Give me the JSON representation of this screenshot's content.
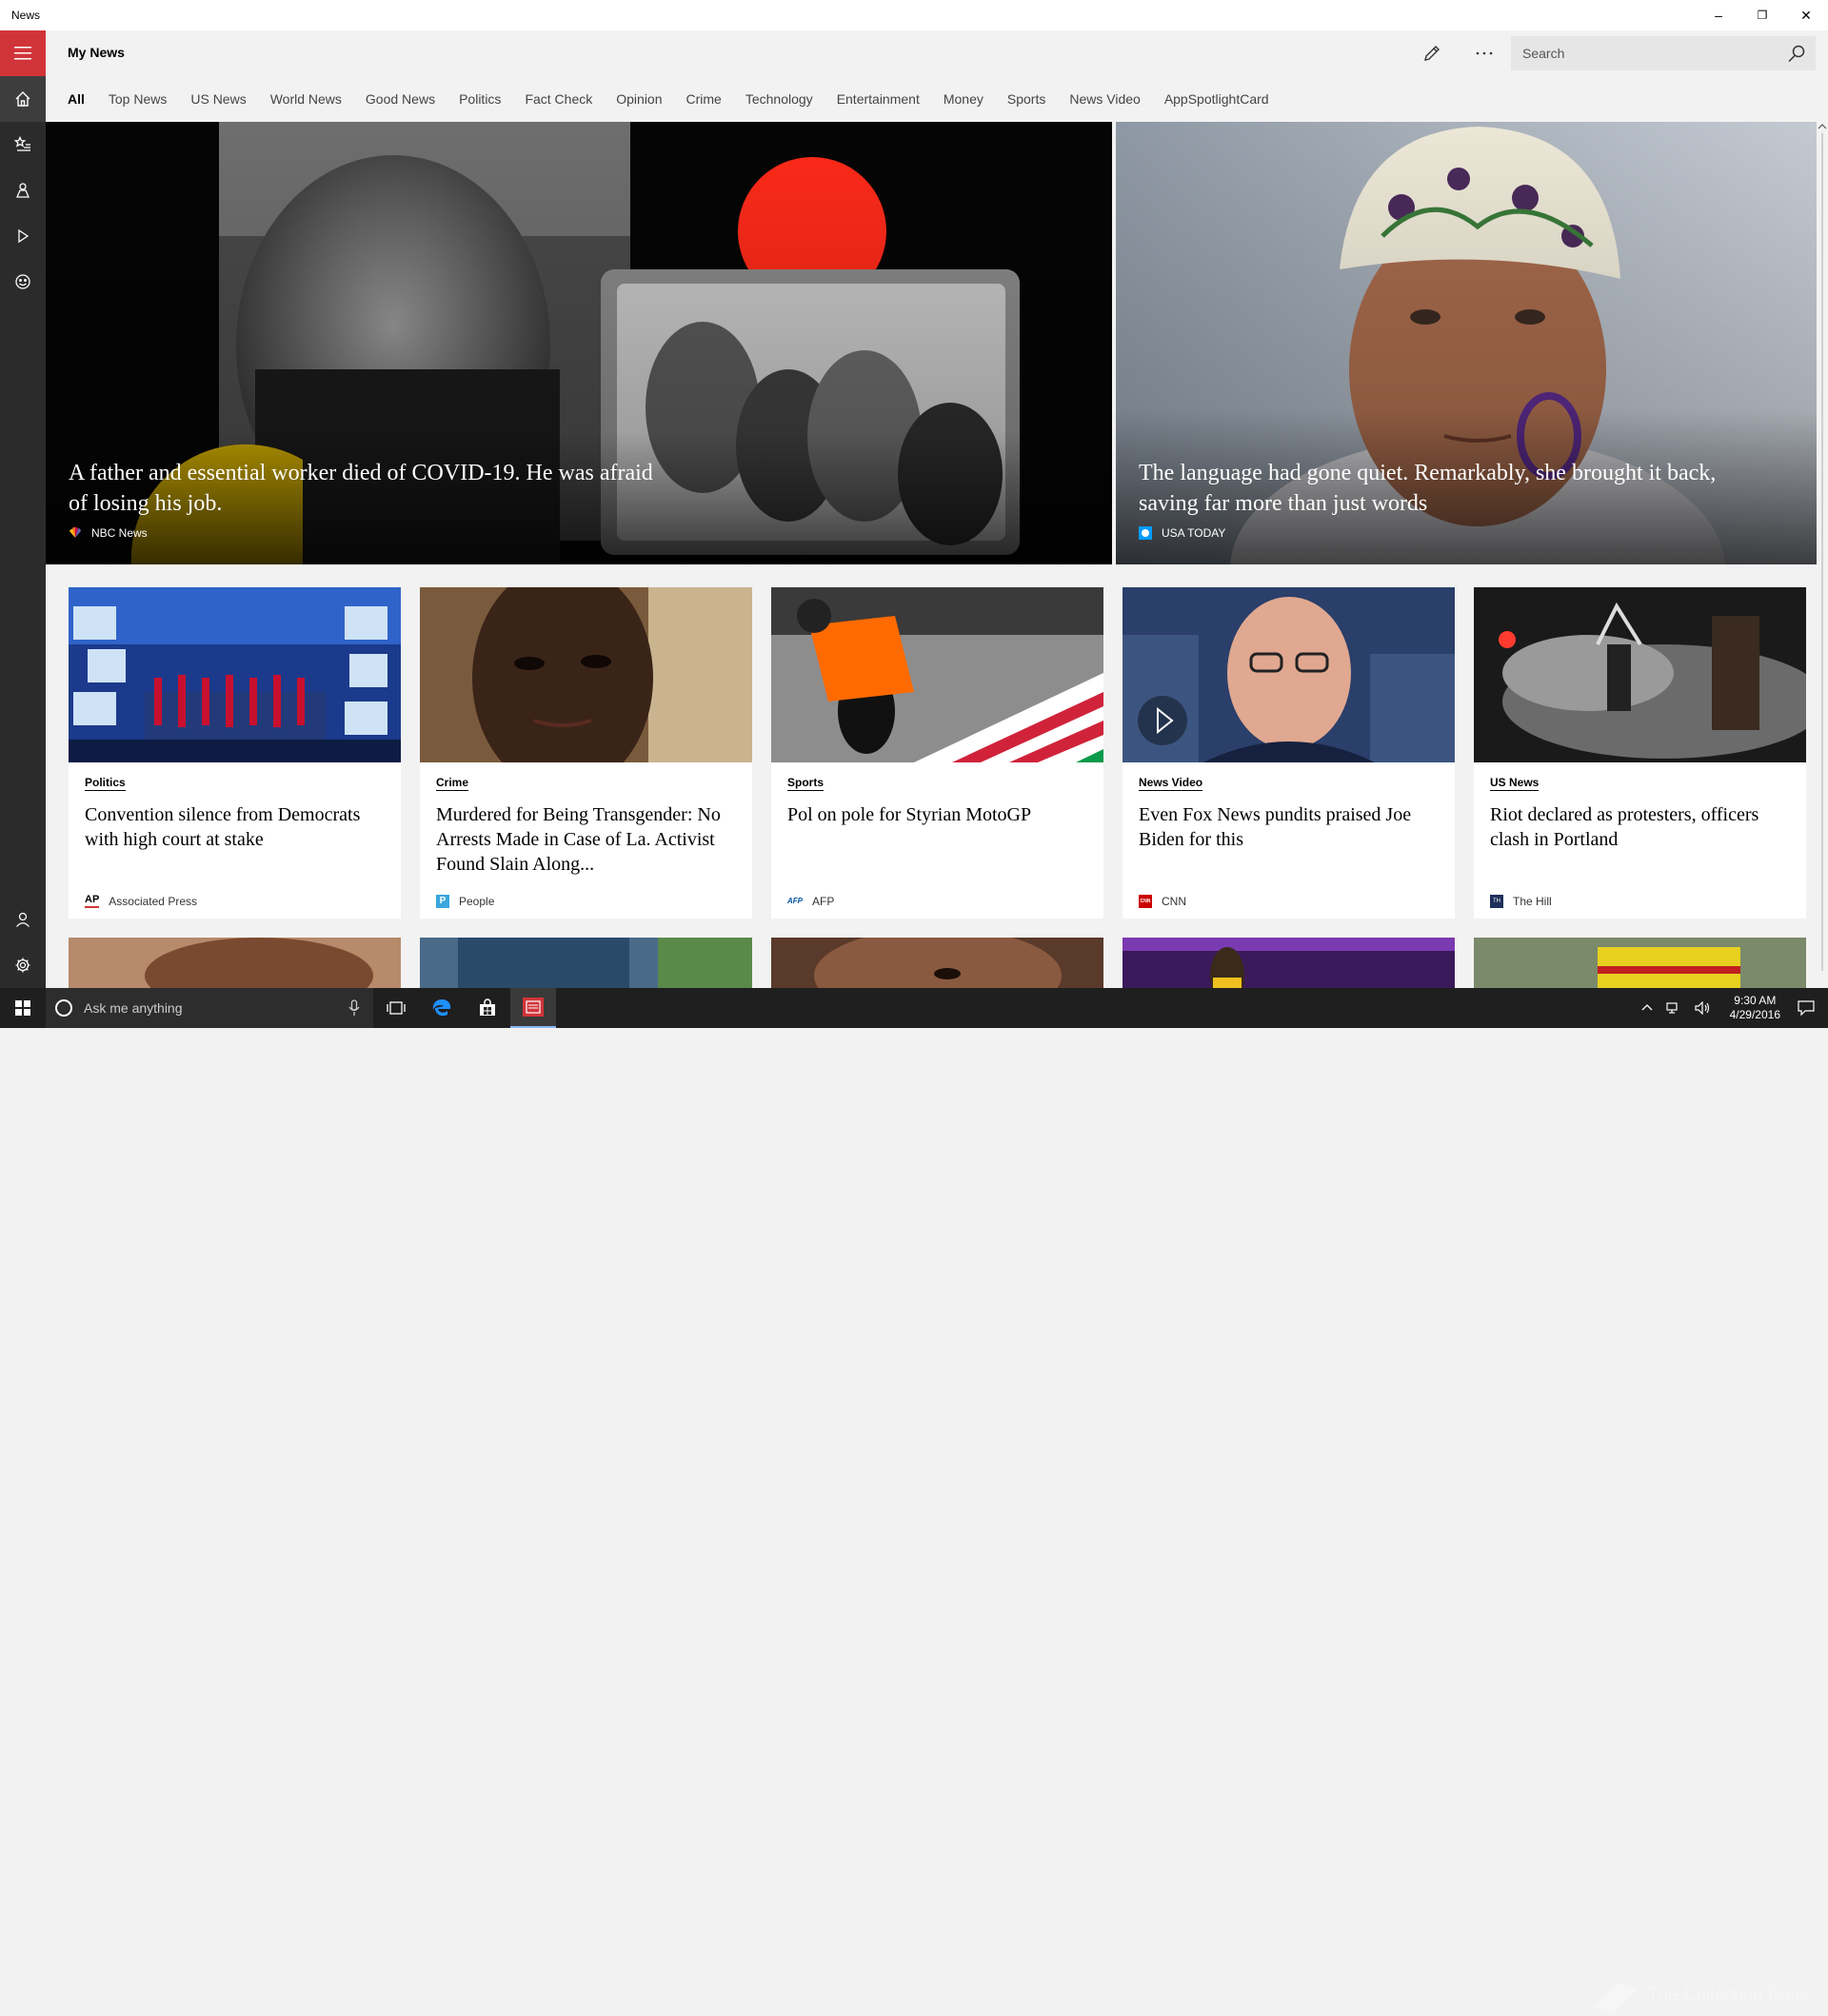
{
  "window": {
    "title": "News",
    "minimize": "–",
    "restore": "❐",
    "close": "✕"
  },
  "header": {
    "page_title": "My News",
    "search_placeholder": "Search"
  },
  "tabs": [
    "All",
    "Top News",
    "US News",
    "World News",
    "Good News",
    "Politics",
    "Fact Check",
    "Opinion",
    "Crime",
    "Technology",
    "Entertainment",
    "Money",
    "Sports",
    "News Video",
    "AppSpotlightCard"
  ],
  "hero": [
    {
      "headline": "A father and essential worker died of COVID-19. He was afraid of losing his job.",
      "source": "NBC News"
    },
    {
      "headline": "The language had gone quiet. Remarkably, she brought it back, saving far more than just words",
      "source": "USA TODAY"
    }
  ],
  "cards": [
    {
      "category": "Politics",
      "title": "Convention silence from Democrats with high court at stake",
      "source": "Associated Press",
      "logo_text": "AP"
    },
    {
      "category": "Crime",
      "title": "Murdered for Being Transgender: No Arrests Made in Case of La. Activist Found Slain Along...",
      "source": "People",
      "logo_text": "P"
    },
    {
      "category": "Sports",
      "title": "Pol on pole for Styrian MotoGP",
      "source": "AFP",
      "logo_text": "AFP"
    },
    {
      "category": "News Video",
      "title": "Even Fox News pundits praised Joe Biden for this",
      "source": "CNN",
      "logo_text": "CNN"
    },
    {
      "category": "US News",
      "title": "Riot declared as protesters, officers clash in Portland",
      "source": "The Hill",
      "logo_text": "TH"
    }
  ],
  "taskbar": {
    "cortana_placeholder": "Ask me anything",
    "time": "9:30 AM",
    "date": "4/29/2016"
  },
  "watermark": "The Collection Book",
  "colors": {
    "accent": "#d13438",
    "sidebar": "#2b2b2b",
    "taskbar": "#1f1f1f"
  }
}
